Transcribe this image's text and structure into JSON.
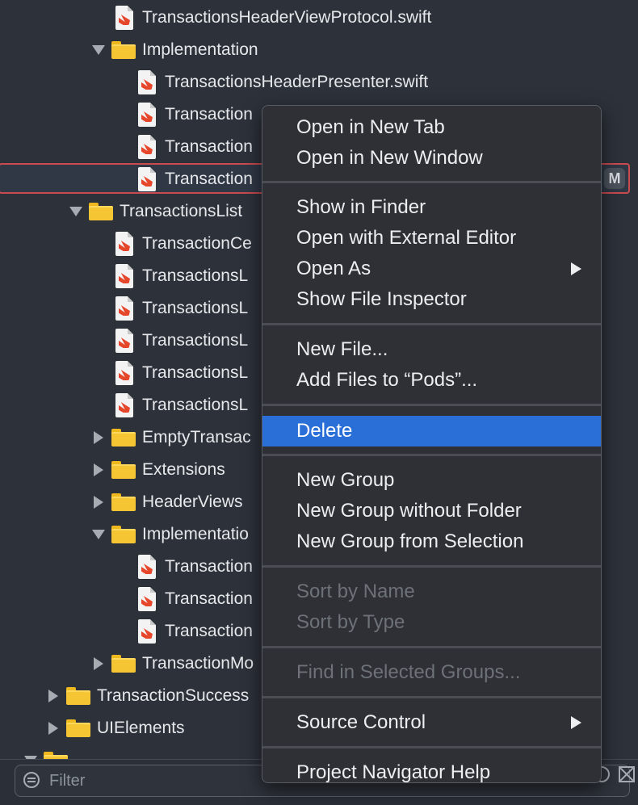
{
  "tree": {
    "rows": [
      {
        "label": "TransactionsHeaderViewProtocol.swift",
        "kind": "file"
      },
      {
        "label": "Implementation",
        "kind": "folder",
        "state": "open"
      },
      {
        "label": "TransactionsHeaderPresenter.swift",
        "kind": "file"
      },
      {
        "label": "Transaction",
        "kind": "file"
      },
      {
        "label": "Transaction",
        "kind": "file"
      },
      {
        "label": "Transaction",
        "kind": "file",
        "badge": "M"
      },
      {
        "label": "TransactionsList",
        "kind": "folder",
        "state": "open"
      },
      {
        "label": "TransactionCe",
        "kind": "file"
      },
      {
        "label": "TransactionsL",
        "kind": "file"
      },
      {
        "label": "TransactionsL",
        "kind": "file"
      },
      {
        "label": "TransactionsL",
        "kind": "file"
      },
      {
        "label": "TransactionsL",
        "kind": "file"
      },
      {
        "label": "TransactionsL",
        "kind": "file"
      },
      {
        "label": "EmptyTransac",
        "kind": "folder",
        "state": "closed"
      },
      {
        "label": "Extensions",
        "kind": "folder",
        "state": "closed"
      },
      {
        "label": "HeaderViews",
        "kind": "folder",
        "state": "closed"
      },
      {
        "label": "Implementatio",
        "kind": "folder",
        "state": "open"
      },
      {
        "label": "Transaction",
        "kind": "file"
      },
      {
        "label": "Transaction",
        "kind": "file"
      },
      {
        "label": "Transaction",
        "kind": "file"
      },
      {
        "label": "TransactionMo",
        "kind": "folder",
        "state": "closed"
      },
      {
        "label": "TransactionSuccess",
        "kind": "folder",
        "state": "closed"
      },
      {
        "label": "UIElements",
        "kind": "folder",
        "state": "closed"
      }
    ]
  },
  "filter": {
    "placeholder": "Filter"
  },
  "context_menu": {
    "items": [
      {
        "label": "Open in New Tab"
      },
      {
        "label": "Open in New Window"
      },
      {
        "label": "Show in Finder"
      },
      {
        "label": "Open with External Editor"
      },
      {
        "label": "Open As"
      },
      {
        "label": "Show File Inspector"
      },
      {
        "label": "New File..."
      },
      {
        "label": "Add Files to “Pods”..."
      },
      {
        "label": "Delete"
      },
      {
        "label": "New Group"
      },
      {
        "label": "New Group without Folder"
      },
      {
        "label": "New Group from Selection"
      },
      {
        "label": "Sort by Name"
      },
      {
        "label": "Sort by Type"
      },
      {
        "label": "Find in Selected Groups..."
      },
      {
        "label": "Source Control"
      },
      {
        "label": "Project Navigator Help"
      }
    ]
  },
  "colors": {
    "accent": "#2a6fd8",
    "folder": "#f5c533",
    "selection_border": "#c94b4f"
  }
}
